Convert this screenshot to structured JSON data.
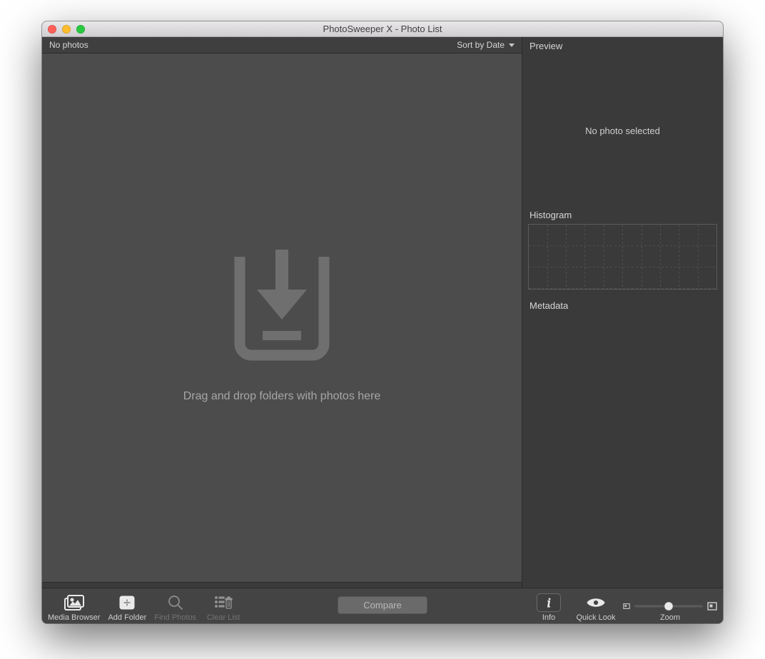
{
  "window": {
    "title": "PhotoSweeper X - Photo List"
  },
  "main": {
    "count_label": "No photos",
    "sort_label": "Sort by Date",
    "drop_text": "Drag and drop folders with photos here"
  },
  "side": {
    "preview_label": "Preview",
    "preview_placeholder": "No photo selected",
    "histogram_label": "Histogram",
    "metadata_label": "Metadata"
  },
  "toolbar": {
    "media_browser": "Media Browser",
    "add_folder": "Add Folder",
    "find_photos": "Find Photos",
    "clear_list": "Clear List",
    "compare": "Compare",
    "info": "Info",
    "quick_look": "Quick Look",
    "zoom": "Zoom",
    "zoom_value_pct": 50
  }
}
